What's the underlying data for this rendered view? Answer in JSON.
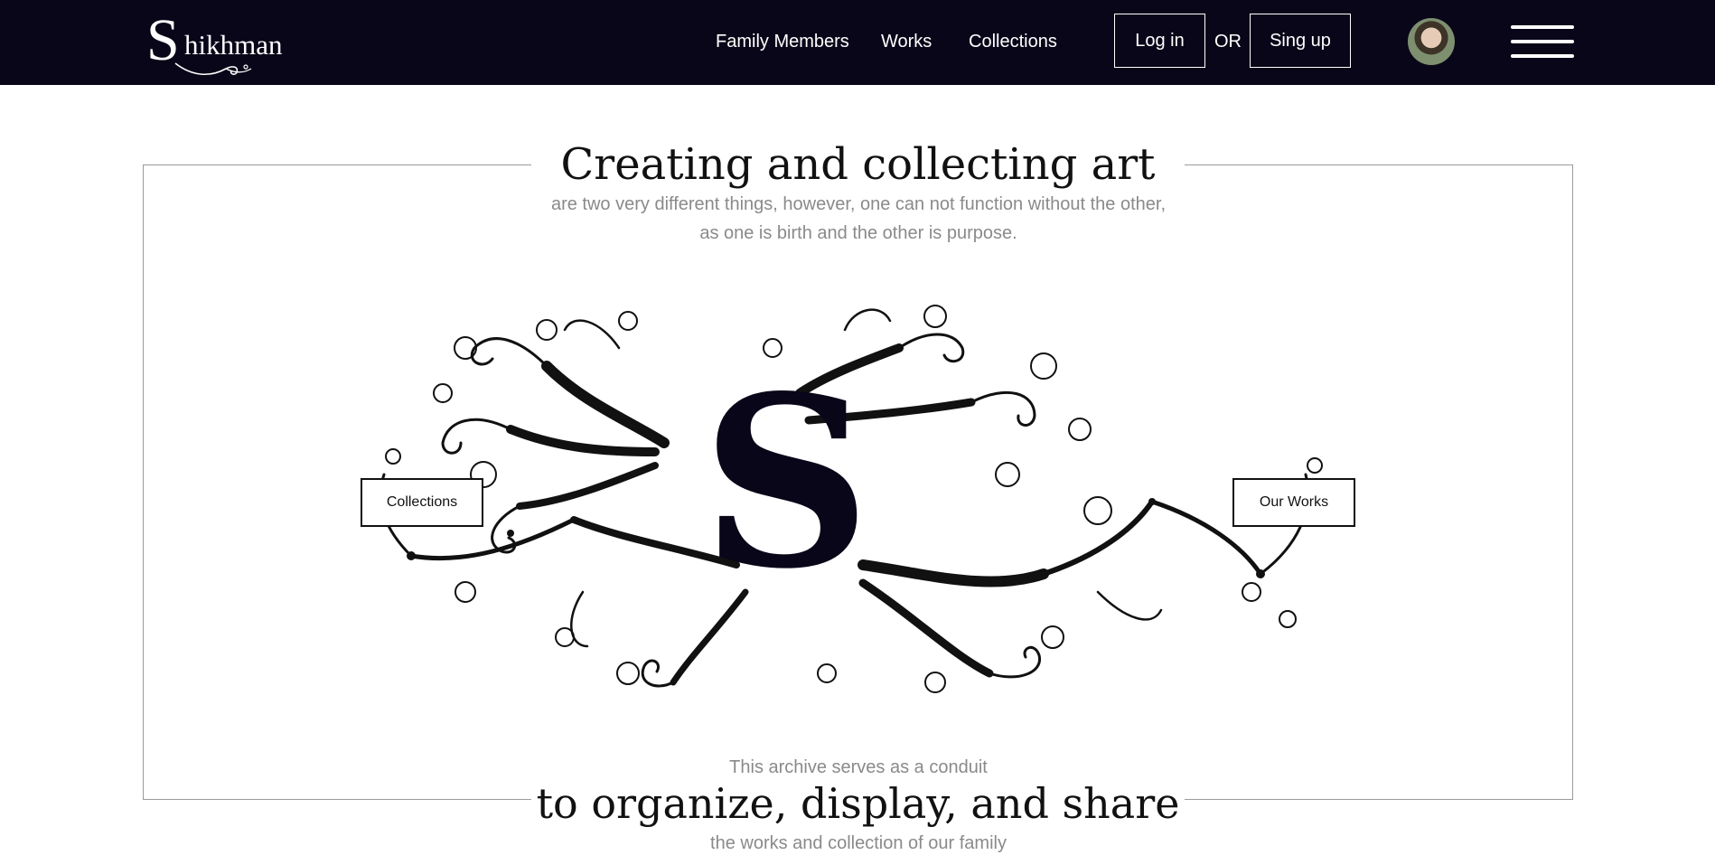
{
  "brand": {
    "logo_initial": "S",
    "logo_rest": "hikhman"
  },
  "nav": {
    "links": [
      "Family Members",
      "Works",
      "Collections"
    ],
    "login_label": "Log in",
    "or_label": "OR",
    "signup_label": "Sing up"
  },
  "hero": {
    "title": "Creating and collecting art",
    "subtitle": "are two very different things, however, one can not function without the other, as one is birth and the other is purpose."
  },
  "tree": {
    "monogram": "S",
    "left_button": "Collections",
    "right_button": "Our Works"
  },
  "section2": {
    "pre_title": "This archive serves as a conduit",
    "title": "to organize, display, and share",
    "post_title": "the works and collection of our family"
  },
  "colors": {
    "nav_bg": "#0a0619",
    "muted_text": "#8a8a8a",
    "ink": "#111111"
  },
  "icons": {
    "menu": "hamburger-icon",
    "avatar": "user-avatar"
  }
}
